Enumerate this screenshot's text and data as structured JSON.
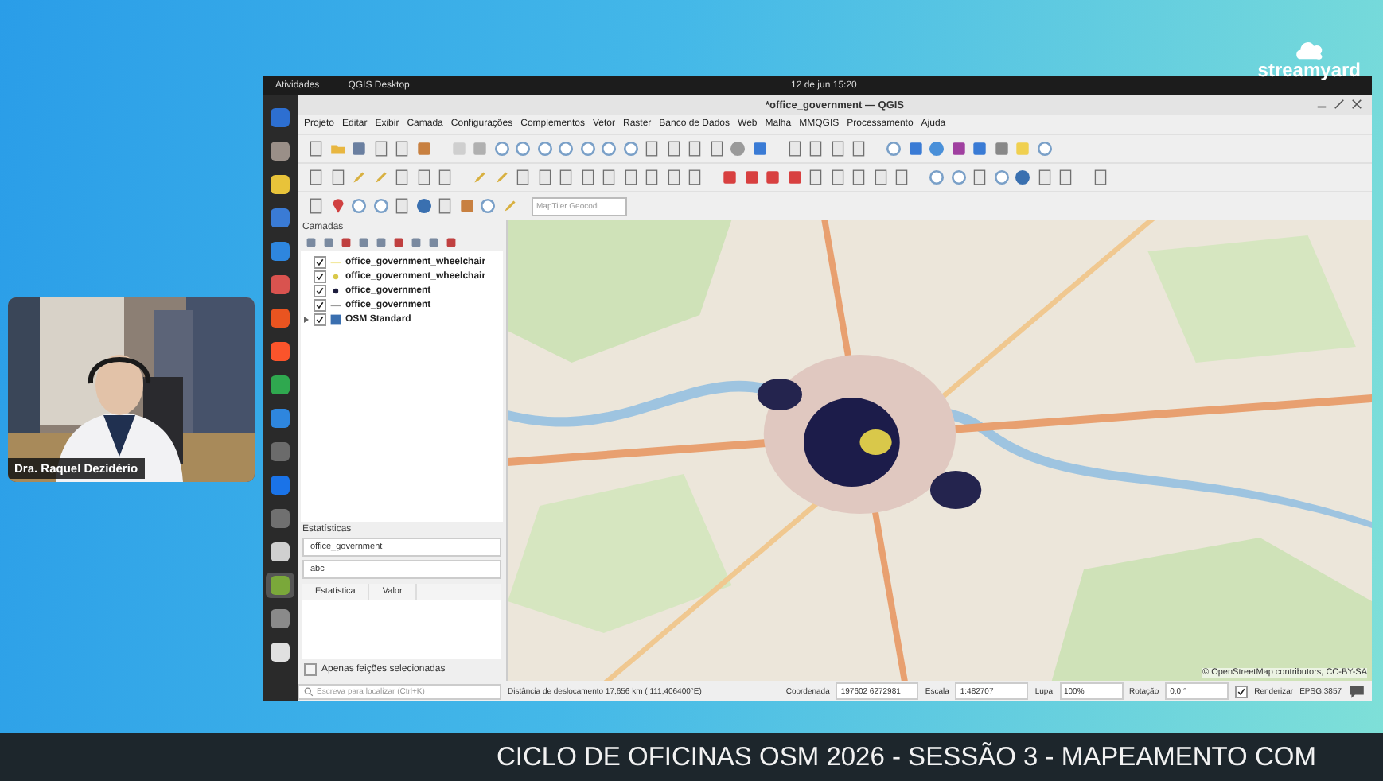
{
  "stream": {
    "logo": "streamyard",
    "speaker": "Dra. Raquel Dezidério",
    "banner": "CICLO DE OFICINAS OSM 2026 - SESSÃO 3 - MAPEAMENTO COM"
  },
  "desktop": {
    "activities": "Atividades",
    "app": "QGIS Desktop",
    "clock": "12 de jun  15:20",
    "dock": [
      {
        "color": "#2d6fd1",
        "selected": false
      },
      {
        "color": "#9a8f88",
        "selected": false
      },
      {
        "color": "#e8c33a",
        "selected": false
      },
      {
        "color": "#3a7bd5",
        "selected": false
      },
      {
        "color": "#2e86de",
        "selected": false
      },
      {
        "color": "#d9534f",
        "selected": false
      },
      {
        "color": "#e95420",
        "selected": false
      },
      {
        "color": "#fb542b",
        "selected": false
      },
      {
        "color": "#2fa84f",
        "selected": false
      },
      {
        "color": "#2e86de",
        "selected": false
      },
      {
        "color": "#6b6b6b",
        "selected": false
      },
      {
        "color": "#1a73e8",
        "selected": false
      },
      {
        "color": "#707070",
        "selected": false
      },
      {
        "color": "#d0d0d0",
        "selected": false
      },
      {
        "color": "#7aa83a",
        "selected": true
      },
      {
        "color": "#8a8a8a",
        "selected": false
      },
      {
        "color": "#e0e0e0",
        "selected": false
      }
    ]
  },
  "window": {
    "title": "*office_government — QGIS"
  },
  "menu": [
    "Projeto",
    "Editar",
    "Exibir",
    "Camada",
    "Configurações",
    "Complementos",
    "Vetor",
    "Raster",
    "Banco de Dados",
    "Web",
    "Malha",
    "MMQGIS",
    "Processamento",
    "Ajuda"
  ],
  "toolbar": {
    "geocoder_placeholder": "MapTiler Geocodi..."
  },
  "layers_panel": {
    "title": "Camadas",
    "layers": [
      {
        "name": "office_government_wheelchair",
        "checked": true,
        "kind": "line",
        "color": "#f3e9a0"
      },
      {
        "name": "office_government_wheelchair",
        "checked": true,
        "kind": "point",
        "color": "#d9c84a"
      },
      {
        "name": "office_government",
        "checked": true,
        "kind": "point",
        "color": "#1c1c3c"
      },
      {
        "name": "office_government",
        "checked": true,
        "kind": "line",
        "color": "#9a9a9a"
      },
      {
        "name": "OSM Standard",
        "checked": true,
        "kind": "raster",
        "color": "#3a6fb0"
      }
    ]
  },
  "stats_panel": {
    "title": "Estatísticas",
    "layer": "office_government",
    "field": "abc",
    "columns": [
      "Estatística",
      "Valor"
    ],
    "selected_only": {
      "label": "Apenas feições selecionadas",
      "checked": false
    }
  },
  "locator": {
    "placeholder": "Escreva para localizar (Ctrl+K)"
  },
  "map": {
    "kind": "picture",
    "attribution": "© OpenStreetMap contributors, CC-BY-SA"
  },
  "status_bar": {
    "message": "Distância de deslocamento 17,656 km ( 111,406400°E)",
    "coordinate_label": "Coordenada",
    "coordinate": "197602 6272981",
    "scale_label": "Escala",
    "scale": "1:482707",
    "magnifier_label": "Lupa",
    "magnifier": "100%",
    "rotation_label": "Rotação",
    "rotation": "0,0 °",
    "render": {
      "label": "Renderizar",
      "checked": true
    },
    "crs": "EPSG:3857"
  }
}
